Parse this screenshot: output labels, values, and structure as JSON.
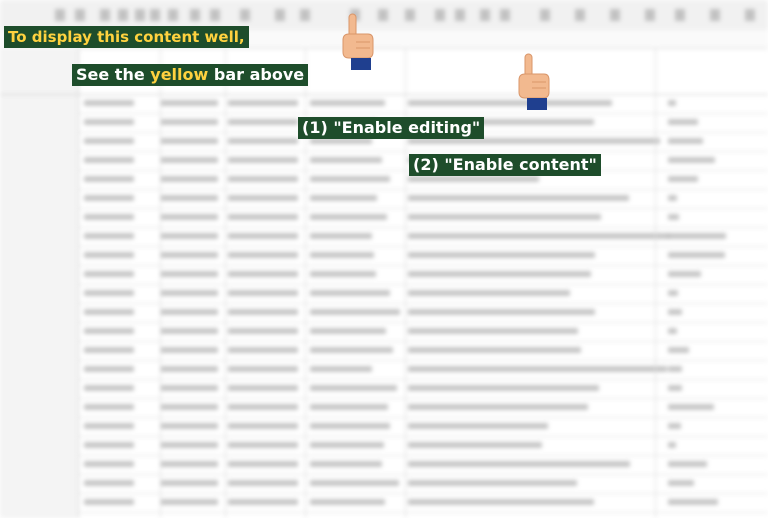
{
  "overlay": {
    "line1": "To display this content well,",
    "line2_prefix": "See the ",
    "line2_highlight": "yellow",
    "line2_suffix": " bar above",
    "step1": "(1) \"Enable editing\"",
    "step2": "(2) \"Enable content\""
  },
  "colors": {
    "label_bg": "#1e4d2b",
    "label_text": "#ffffff",
    "highlight": "#ffd23f",
    "skin": "#f2b98f",
    "sleeve": "#1f3f8f"
  },
  "icons": {
    "hand1": "pointing-hand-icon",
    "hand2": "pointing-hand-icon"
  }
}
